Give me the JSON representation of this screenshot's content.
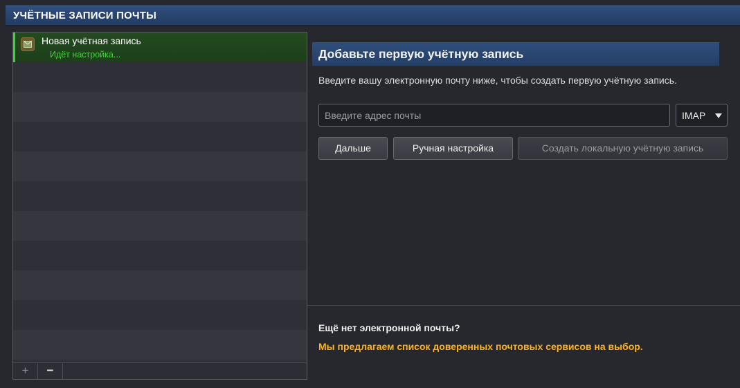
{
  "header": {
    "title": "УЧЁТНЫЕ ЗАПИСИ ПОЧТЫ"
  },
  "accounts": [
    {
      "name": "Новая учётная запись",
      "status": "Идёт настройка...",
      "icon": "mail-icon",
      "status_color": "#3fd93a"
    }
  ],
  "list_footer": {
    "add_label": "+",
    "remove_label": "−"
  },
  "setup": {
    "title": "Добавьте первую учётную запись",
    "intro": "Введите вашу электронную почту ниже, чтобы создать первую учётную запись.",
    "email_placeholder": "Введите адрес почты",
    "protocol": "IMAP",
    "next_label": "Дальше",
    "manual_label": "Ручная настройка",
    "local_label": "Создать локальную учётную запись"
  },
  "no_email": {
    "title": "Ещё нет электронной почты?",
    "link": "Мы предлагаем список доверенных почтовых сервисов на выбор.",
    "link_color": "#ffb21a"
  },
  "colors": {
    "header_blue": "#2f4e7c",
    "selection_green": "#3bd43b",
    "background": "#27272e"
  }
}
